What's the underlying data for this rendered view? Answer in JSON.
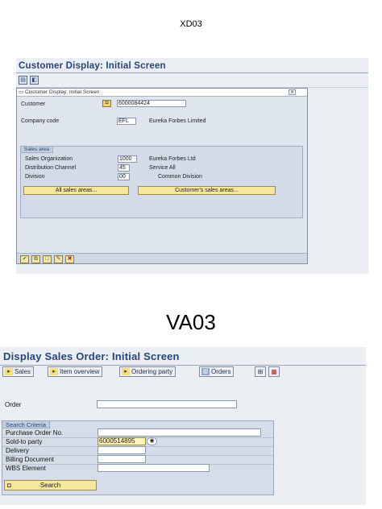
{
  "titles": {
    "top": "XD03",
    "bottom": "VA03"
  },
  "xd03": {
    "screen_title": "Customer Display: Initial Screen",
    "toolbar_icons": [
      "copy-icon",
      "display-icon"
    ],
    "dialog": {
      "title": "Customer Display: Initial Screen",
      "customer_label": "Customer",
      "customer_value": "6000084424",
      "company_code_label": "Company code",
      "company_code_value": "EFL",
      "company_code_desc": "Eureka Forbes Limited",
      "sales_area": {
        "heading": "Sales area",
        "sales_org_label": "Sales Organization",
        "sales_org_value": "1000",
        "sales_org_desc": "Eureka Forbes Ltd",
        "dist_channel_label": "Distribution Channel",
        "dist_channel_value": "45",
        "dist_channel_desc": "Service All",
        "division_label": "Division",
        "division_value": "00",
        "division_desc": "Common Division",
        "all_sales_areas_button": "All sales areas...",
        "customers_sales_areas_button": "Customer's sales areas..."
      },
      "footer_icons": [
        "checkmark-icon",
        "data-icon",
        "new-icon",
        "edit-icon",
        "cancel-icon"
      ]
    }
  },
  "va03": {
    "screen_title": "Display Sales Order: Initial Screen",
    "app_toolbar": {
      "sales": "Sales",
      "item_overview": "Item overview",
      "ordering_party": "Ordering party",
      "orders": "Orders"
    },
    "order_label": "Order",
    "order_value": "",
    "search_criteria": {
      "heading": "Search Criteria",
      "purchase_order_label": "Purchase Order No.",
      "purchase_order_value": "",
      "sold_to_label": "Sold-to party",
      "sold_to_value": "6000514895",
      "delivery_label": "Delivery",
      "delivery_value": "",
      "billing_label": "Billing Document",
      "billing_value": "",
      "wbs_label": "WBS Element",
      "wbs_value": "",
      "search_button": "Search"
    }
  }
}
